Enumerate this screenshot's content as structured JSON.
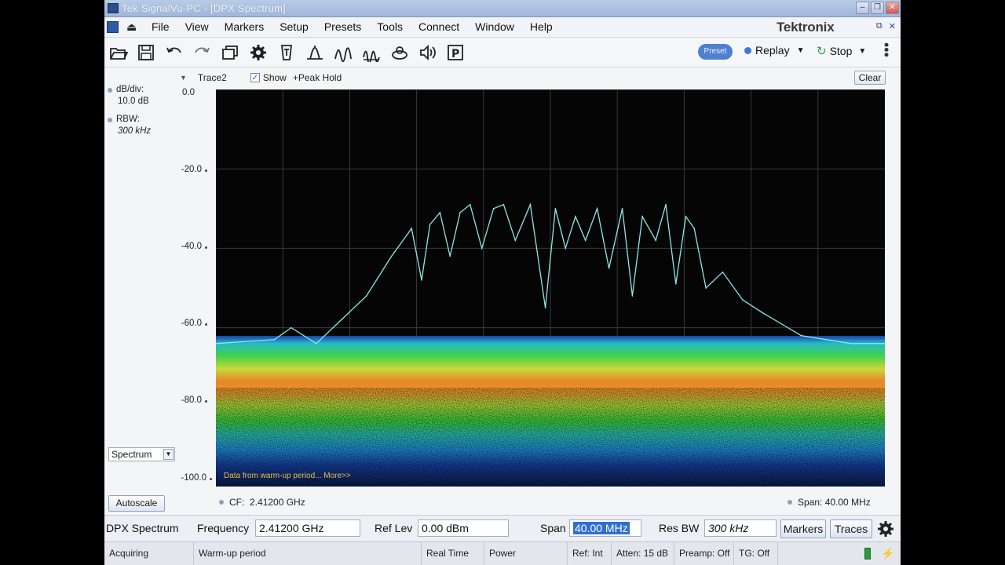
{
  "window": {
    "title": "Tek SignalVu-PC - [DPX Spectrum]"
  },
  "menu": {
    "items": [
      "File",
      "View",
      "Markers",
      "Setup",
      "Presets",
      "Tools",
      "Connect",
      "Window",
      "Help"
    ],
    "brand": "Tektronix"
  },
  "toolbar": {
    "preset_label": "Preset",
    "replay_label": "Replay",
    "stop_label": "Stop",
    "icons": [
      "open-icon",
      "save-icon",
      "undo-icon",
      "redo-icon",
      "windows-icon",
      "settings-icon",
      "trigger-icon",
      "acquire-icon",
      "amplitude-icon",
      "frequency-icon",
      "record-icon",
      "audio-icon",
      "presets-p-icon"
    ]
  },
  "display": {
    "trace_name": "Trace2",
    "show_label": "Show",
    "show_checked": true,
    "detection_label": "+Peak Hold",
    "clear_label": "Clear",
    "db_div_label": "dB/div:",
    "db_div_value": "10.0 dB",
    "rbw_label": "RBW:",
    "rbw_value": "300 kHz",
    "y_ticks": [
      "0.0",
      "-20.0",
      "-40.0",
      "-60.0",
      "-80.0",
      "-100.0"
    ],
    "mode_select": "Spectrum",
    "autoscale_label": "Autoscale",
    "cf_label": "CF:",
    "cf_value": "2.41200 GHz",
    "span_label": "Span:",
    "span_value": "40.00 MHz",
    "warmup_note": "Data from warm-up period... More>>"
  },
  "settings": {
    "view_name": "DPX Spectrum",
    "frequency_label": "Frequency",
    "frequency_value": "2.41200 GHz",
    "reflev_label": "Ref Lev",
    "reflev_value": "0.00 dBm",
    "span_label": "Span",
    "span_value": "40.00 MHz",
    "resbw_label": "Res BW",
    "resbw_value": "300 kHz",
    "markers_label": "Markers",
    "traces_label": "Traces"
  },
  "status": {
    "state": "Acquiring",
    "message": "Warm-up period",
    "mode": "Real Time",
    "power": "Power",
    "ref": "Ref: Int",
    "atten": "Atten: 15 dB",
    "preamp": "Preamp: Off",
    "tg": "TG: Off"
  },
  "chart_data": {
    "type": "line",
    "ylabel": "",
    "ylim": [
      -100,
      0
    ],
    "y_ticks": [
      0,
      -20,
      -40,
      -60,
      -80,
      -100
    ],
    "x_unit": "MHz offset from CF",
    "xlim": [
      -20,
      20
    ],
    "grid": true,
    "series": [
      {
        "name": "Trace2",
        "x": [
          -20,
          -16.5,
          -15.5,
          -14,
          -12.5,
          -11,
          -9.5,
          -8.3,
          -7.7,
          -7.2,
          -6.6,
          -6,
          -5.4,
          -4.8,
          -4.1,
          -3.4,
          -2.8,
          -2.1,
          -1.2,
          -0.3,
          0.3,
          0.9,
          1.5,
          2.1,
          2.8,
          3.5,
          4.3,
          4.9,
          5.5,
          6.3,
          6.9,
          7.5,
          8.1,
          8.6,
          9.3,
          10.3,
          11.5,
          12.6,
          13.8,
          15,
          16.5,
          18,
          20
        ],
        "y": [
          -64,
          -63,
          -60,
          -64,
          -58,
          -52,
          -42,
          -35,
          -48,
          -34,
          -31,
          -42,
          -31,
          -29,
          -40,
          -30,
          -29,
          -38,
          -29,
          -55,
          -30,
          -40,
          -32,
          -38,
          -30,
          -45,
          -30,
          -52,
          -32,
          -38,
          -29,
          -49,
          -32,
          -35,
          -50,
          -46,
          -53,
          -56,
          -59,
          -62,
          -63,
          -64,
          -64
        ]
      }
    ]
  }
}
